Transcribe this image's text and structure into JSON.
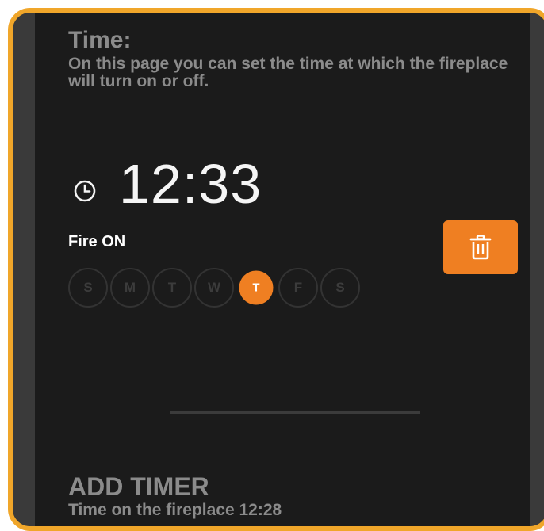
{
  "header": {
    "title": "Time:",
    "description": "On this page you can set the time at which the fireplace will turn on or off."
  },
  "timer": {
    "time": "12:33",
    "action": "Fire ON",
    "days": [
      {
        "label": "S",
        "active": false
      },
      {
        "label": "M",
        "active": false
      },
      {
        "label": "T",
        "active": false
      },
      {
        "label": "W",
        "active": false
      },
      {
        "label": "T",
        "active": true
      },
      {
        "label": "F",
        "active": false
      },
      {
        "label": "S",
        "active": false
      }
    ]
  },
  "add_timer": {
    "title": "ADD TIMER",
    "subtitle": "Time on the fireplace 12:28"
  },
  "icons": {
    "clock": "clock-icon",
    "delete": "trash-icon"
  },
  "colors": {
    "accent": "#ef7f22",
    "frame": "#f0a62a",
    "background": "#1b1b1b"
  }
}
